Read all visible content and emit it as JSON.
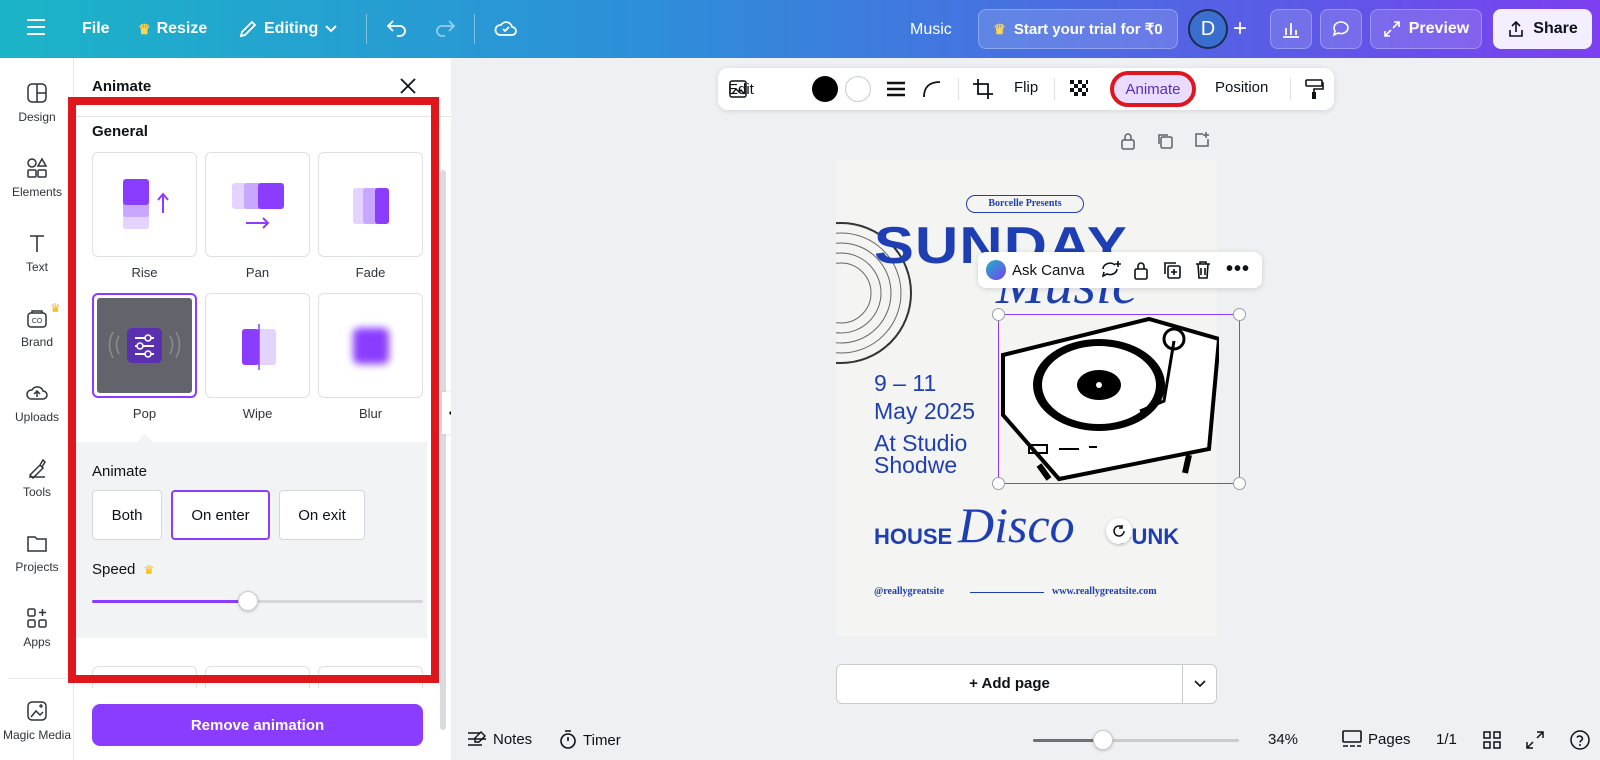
{
  "topbar": {
    "file_label": "File",
    "resize_label": "Resize",
    "editing_label": "Editing",
    "doc_title": "Music",
    "trial_label": "Start your trial for ₹0",
    "avatar_initial": "D",
    "preview_label": "Preview",
    "share_label": "Share"
  },
  "rail": {
    "items": [
      {
        "label": "Design",
        "icon": "design-icon"
      },
      {
        "label": "Elements",
        "icon": "elements-icon"
      },
      {
        "label": "Text",
        "icon": "text-icon"
      },
      {
        "label": "Brand",
        "icon": "brand-icon"
      },
      {
        "label": "Uploads",
        "icon": "uploads-icon"
      },
      {
        "label": "Tools",
        "icon": "tools-icon"
      },
      {
        "label": "Projects",
        "icon": "projects-icon"
      },
      {
        "label": "Apps",
        "icon": "apps-icon"
      },
      {
        "label": "Magic Media",
        "icon": "magic-media-icon"
      }
    ]
  },
  "panel": {
    "title": "Animate",
    "general_title": "General",
    "effects": [
      {
        "label": "Rise"
      },
      {
        "label": "Pan"
      },
      {
        "label": "Fade"
      },
      {
        "label": "Pop"
      },
      {
        "label": "Wipe"
      },
      {
        "label": "Blur"
      }
    ],
    "selected_effect": "Pop",
    "animate_title": "Animate",
    "animate_options": [
      "Both",
      "On enter",
      "On exit"
    ],
    "animate_selected": "On enter",
    "speed_title": "Speed",
    "speed_value": 0.47,
    "remove_label": "Remove animation"
  },
  "context_toolbar": {
    "edit_label": "Edit",
    "flip_label": "Flip",
    "animate_label": "Animate",
    "position_label": "Position"
  },
  "floating_bar": {
    "ask_label": "Ask Canva"
  },
  "poster": {
    "presenter": "Borcelle Presents",
    "headline": "SUNDAY",
    "script_word": "Music",
    "dates": "9 – 11",
    "month": "May 2025",
    "venue1": "At Studio",
    "venue2": "Shodwe",
    "genre_left": "HOUSE",
    "genre_script": "Disco",
    "genre_right": "FUNK",
    "handle": "@reallygreatsite",
    "website": "www.reallygreatsite.com"
  },
  "canvas": {
    "add_page_label": "+ Add page"
  },
  "bottom": {
    "notes_label": "Notes",
    "timer_label": "Timer",
    "zoom_label": "34%",
    "zoom_value": 0.34,
    "pages_label": "Pages",
    "page_count": "1/1"
  },
  "colors": {
    "accent": "#8b3dff",
    "poster_blue": "#1e3fb3",
    "highlight_red": "#e0161d"
  }
}
